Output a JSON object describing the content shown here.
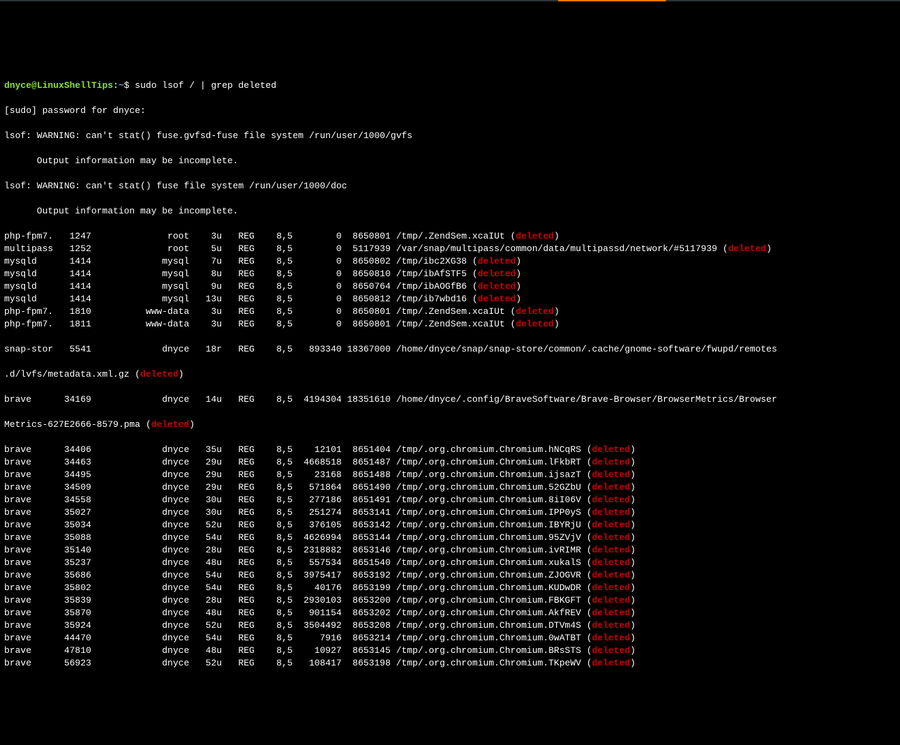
{
  "prompt": {
    "user": "dnyce",
    "at": "@",
    "host": "LinuxShellTips",
    "colon": ":",
    "cwd": "~",
    "dollar": "$",
    "command": " sudo lsof / | grep deleted"
  },
  "sudo_line": "[sudo] password for dnyce:",
  "warn1": "lsof: WARNING: can't stat() fuse.gvfsd-fuse file system /run/user/1000/gvfs",
  "warn1b": "      Output information may be incomplete.",
  "warn2": "lsof: WARNING: can't stat() fuse file system /run/user/1000/doc",
  "warn2b": "      Output information may be incomplete.",
  "rows": [
    {
      "cmd": "php-fpm7.",
      "pid": "1247",
      "user": "root",
      "fd": "3u",
      "type": "REG",
      "dev": "8,5",
      "size": "0",
      "node": "8650801",
      "name": "/tmp/.ZendSem.xcaIUt",
      "tag": "deleted"
    },
    {
      "cmd": "multipass",
      "pid": "1252",
      "user": "root",
      "fd": "5u",
      "type": "REG",
      "dev": "8,5",
      "size": "0",
      "node": "5117939",
      "name": "/var/snap/multipass/common/data/multipassd/network/#5117939",
      "tag": "deleted"
    },
    {
      "cmd": "mysqld",
      "pid": "1414",
      "user": "mysql",
      "fd": "7u",
      "type": "REG",
      "dev": "8,5",
      "size": "0",
      "node": "8650802",
      "name": "/tmp/ibc2XG38",
      "tag": "deleted"
    },
    {
      "cmd": "mysqld",
      "pid": "1414",
      "user": "mysql",
      "fd": "8u",
      "type": "REG",
      "dev": "8,5",
      "size": "0",
      "node": "8650810",
      "name": "/tmp/ibAfSTF5",
      "tag": "deleted"
    },
    {
      "cmd": "mysqld",
      "pid": "1414",
      "user": "mysql",
      "fd": "9u",
      "type": "REG",
      "dev": "8,5",
      "size": "0",
      "node": "8650764",
      "name": "/tmp/ibAOGfB6",
      "tag": "deleted"
    },
    {
      "cmd": "mysqld",
      "pid": "1414",
      "user": "mysql",
      "fd": "13u",
      "type": "REG",
      "dev": "8,5",
      "size": "0",
      "node": "8650812",
      "name": "/tmp/ib7wbd16",
      "tag": "deleted"
    },
    {
      "cmd": "php-fpm7.",
      "pid": "1810",
      "user": "www-data",
      "fd": "3u",
      "type": "REG",
      "dev": "8,5",
      "size": "0",
      "node": "8650801",
      "name": "/tmp/.ZendSem.xcaIUt",
      "tag": "deleted"
    },
    {
      "cmd": "php-fpm7.",
      "pid": "1811",
      "user": "www-data",
      "fd": "3u",
      "type": "REG",
      "dev": "8,5",
      "size": "0",
      "node": "8650801",
      "name": "/tmp/.ZendSem.xcaIUt",
      "tag": "deleted"
    }
  ],
  "snap_line_a": "snap-stor   5541             dnyce   18r   REG    8,5   893340 18367000 /home/dnyce/snap/snap-store/common/.cache/gnome-software/fwupd/remotes",
  "snap_line_b_pre": ".d/lvfs/metadata.xml.gz (",
  "snap_line_b_tag": "deleted",
  "snap_line_b_post": ")",
  "brave_a": "brave      34169             dnyce   14u   REG    8,5  4194304 18351610 /home/dnyce/.config/BraveSoftware/Brave-Browser/BrowserMetrics/Browser",
  "brave_b_pre": "Metrics-627E2666-8579.pma (",
  "brave_b_tag": "deleted",
  "brave_b_post": ")",
  "rows2": [
    {
      "cmd": "brave",
      "pid": "34406",
      "user": "dnyce",
      "fd": "35u",
      "type": "REG",
      "dev": "8,5",
      "size": "12101",
      "node": "8651404",
      "name": "/tmp/.org.chromium.Chromium.hNCqRS",
      "tag": "deleted"
    },
    {
      "cmd": "brave",
      "pid": "34463",
      "user": "dnyce",
      "fd": "29u",
      "type": "REG",
      "dev": "8,5",
      "size": "4668518",
      "node": "8651487",
      "name": "/tmp/.org.chromium.Chromium.lFkbRT",
      "tag": "deleted"
    },
    {
      "cmd": "brave",
      "pid": "34495",
      "user": "dnyce",
      "fd": "29u",
      "type": "REG",
      "dev": "8,5",
      "size": "23168",
      "node": "8651488",
      "name": "/tmp/.org.chromium.Chromium.ijsazT",
      "tag": "deleted"
    },
    {
      "cmd": "brave",
      "pid": "34509",
      "user": "dnyce",
      "fd": "29u",
      "type": "REG",
      "dev": "8,5",
      "size": "571864",
      "node": "8651490",
      "name": "/tmp/.org.chromium.Chromium.52GZbU",
      "tag": "deleted"
    },
    {
      "cmd": "brave",
      "pid": "34558",
      "user": "dnyce",
      "fd": "30u",
      "type": "REG",
      "dev": "8,5",
      "size": "277186",
      "node": "8651491",
      "name": "/tmp/.org.chromium.Chromium.8iI06V",
      "tag": "deleted"
    },
    {
      "cmd": "brave",
      "pid": "35027",
      "user": "dnyce",
      "fd": "30u",
      "type": "REG",
      "dev": "8,5",
      "size": "251274",
      "node": "8653141",
      "name": "/tmp/.org.chromium.Chromium.IPP0yS",
      "tag": "deleted"
    },
    {
      "cmd": "brave",
      "pid": "35034",
      "user": "dnyce",
      "fd": "52u",
      "type": "REG",
      "dev": "8,5",
      "size": "376105",
      "node": "8653142",
      "name": "/tmp/.org.chromium.Chromium.IBYRjU",
      "tag": "deleted"
    },
    {
      "cmd": "brave",
      "pid": "35088",
      "user": "dnyce",
      "fd": "54u",
      "type": "REG",
      "dev": "8,5",
      "size": "4626994",
      "node": "8653144",
      "name": "/tmp/.org.chromium.Chromium.95ZVjV",
      "tag": "deleted"
    },
    {
      "cmd": "brave",
      "pid": "35140",
      "user": "dnyce",
      "fd": "28u",
      "type": "REG",
      "dev": "8,5",
      "size": "2318882",
      "node": "8653146",
      "name": "/tmp/.org.chromium.Chromium.ivRIMR",
      "tag": "deleted"
    },
    {
      "cmd": "brave",
      "pid": "35237",
      "user": "dnyce",
      "fd": "48u",
      "type": "REG",
      "dev": "8,5",
      "size": "557534",
      "node": "8651540",
      "name": "/tmp/.org.chromium.Chromium.xukalS",
      "tag": "deleted"
    },
    {
      "cmd": "brave",
      "pid": "35686",
      "user": "dnyce",
      "fd": "54u",
      "type": "REG",
      "dev": "8,5",
      "size": "3975417",
      "node": "8653192",
      "name": "/tmp/.org.chromium.Chromium.ZJOGVR",
      "tag": "deleted"
    },
    {
      "cmd": "brave",
      "pid": "35802",
      "user": "dnyce",
      "fd": "54u",
      "type": "REG",
      "dev": "8,5",
      "size": "40176",
      "node": "8653199",
      "name": "/tmp/.org.chromium.Chromium.KUDwDR",
      "tag": "deleted"
    },
    {
      "cmd": "brave",
      "pid": "35839",
      "user": "dnyce",
      "fd": "28u",
      "type": "REG",
      "dev": "8,5",
      "size": "2930103",
      "node": "8653200",
      "name": "/tmp/.org.chromium.Chromium.FBKGFT",
      "tag": "deleted"
    },
    {
      "cmd": "brave",
      "pid": "35870",
      "user": "dnyce",
      "fd": "48u",
      "type": "REG",
      "dev": "8,5",
      "size": "901154",
      "node": "8653202",
      "name": "/tmp/.org.chromium.Chromium.AkfREV",
      "tag": "deleted"
    },
    {
      "cmd": "brave",
      "pid": "35924",
      "user": "dnyce",
      "fd": "52u",
      "type": "REG",
      "dev": "8,5",
      "size": "3504492",
      "node": "8653208",
      "name": "/tmp/.org.chromium.Chromium.DTVm4S",
      "tag": "deleted"
    },
    {
      "cmd": "brave",
      "pid": "44470",
      "user": "dnyce",
      "fd": "54u",
      "type": "REG",
      "dev": "8,5",
      "size": "7916",
      "node": "8653214",
      "name": "/tmp/.org.chromium.Chromium.0wATBT",
      "tag": "deleted"
    },
    {
      "cmd": "brave",
      "pid": "47810",
      "user": "dnyce",
      "fd": "48u",
      "type": "REG",
      "dev": "8,5",
      "size": "10927",
      "node": "8653145",
      "name": "/tmp/.org.chromium.Chromium.BRsSTS",
      "tag": "deleted"
    },
    {
      "cmd": "brave",
      "pid": "56923",
      "user": "dnyce",
      "fd": "52u",
      "type": "REG",
      "dev": "8,5",
      "size": "108417",
      "node": "8653198",
      "name": "/tmp/.org.chromium.Chromium.TKpeWV",
      "tag": "deleted"
    }
  ]
}
